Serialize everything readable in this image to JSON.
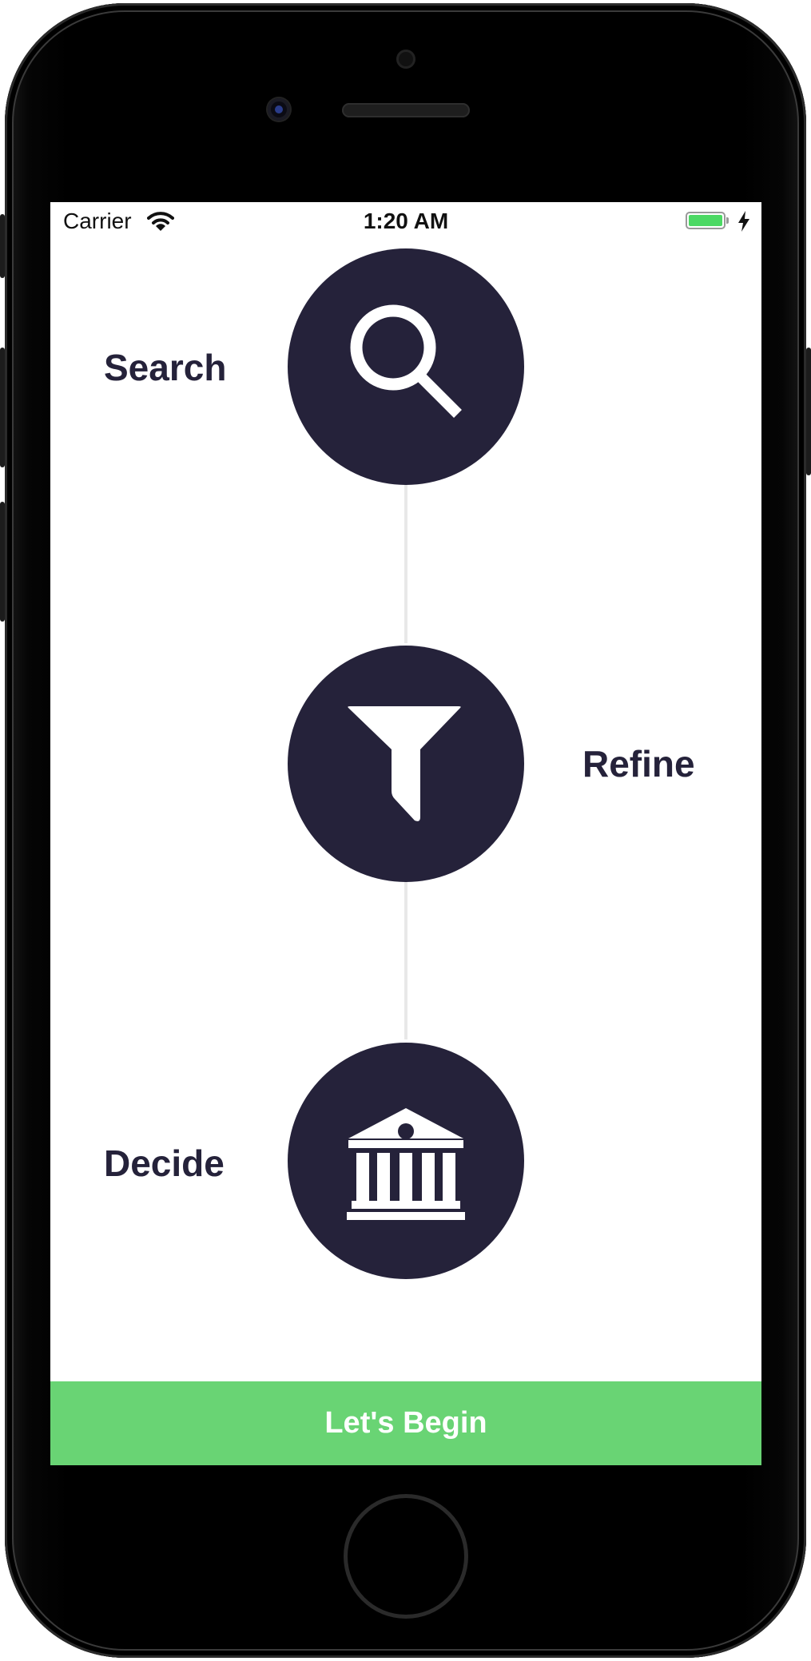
{
  "status_bar": {
    "carrier": "Carrier",
    "time": "1:20 AM",
    "battery_color": "#4cd964"
  },
  "steps": [
    {
      "label": "Search",
      "icon": "search-icon"
    },
    {
      "label": "Refine",
      "icon": "filter-icon"
    },
    {
      "label": "Decide",
      "icon": "bank-icon"
    }
  ],
  "cta": {
    "label": "Let's Begin",
    "color": "#69d474"
  },
  "colors": {
    "circle": "#25223a",
    "text": "#25223a",
    "connector": "#e8e8e8"
  }
}
